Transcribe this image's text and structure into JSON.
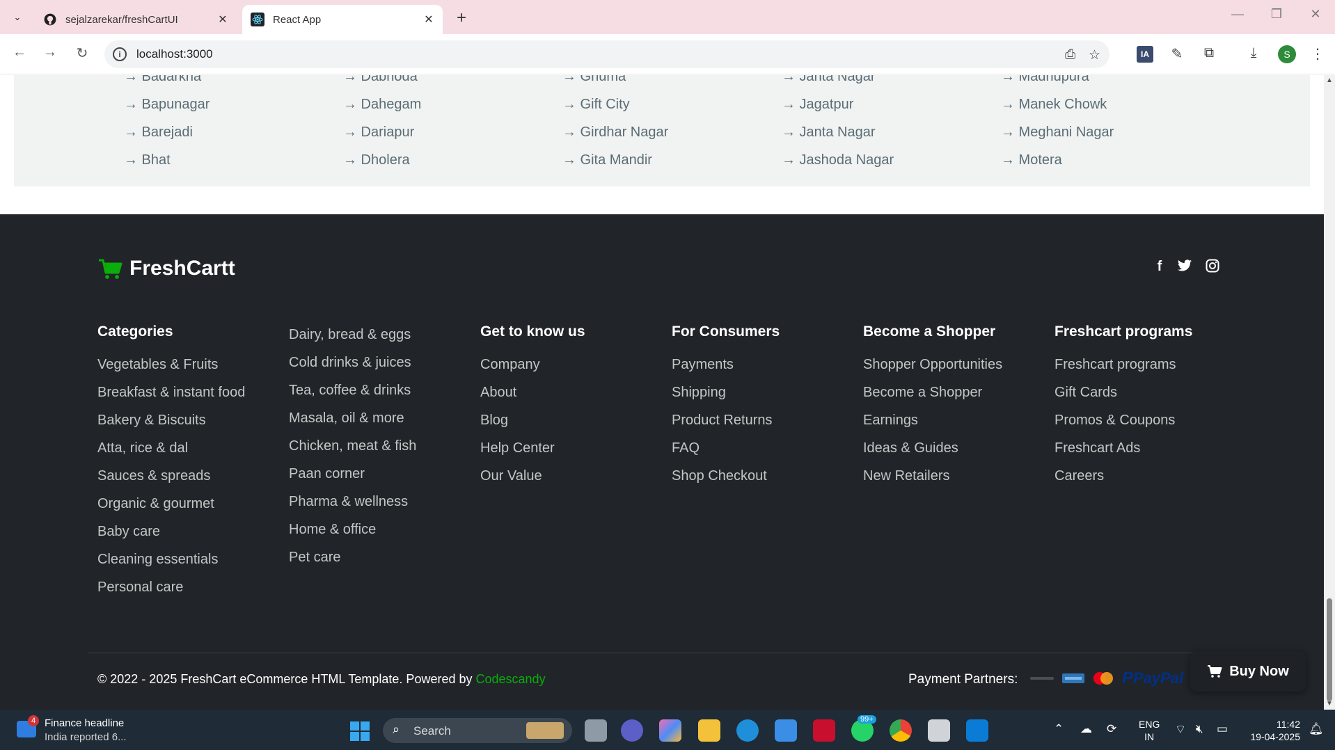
{
  "browser": {
    "tabs": [
      {
        "title": "sejalzarekar/freshCartUI",
        "icon": "github-icon",
        "active": false
      },
      {
        "title": "React App",
        "icon": "react-icon",
        "active": true
      }
    ],
    "new_tab": "+",
    "url": "localhost:3000",
    "profile_initial": "S",
    "extension_badge": "IA"
  },
  "locations": {
    "columns": [
      [
        "→ Badarkha",
        "→ Bapunagar",
        "→ Barejadi",
        "→ Bhat"
      ],
      [
        "→ Dabhoda",
        "→ Dahegam",
        "→ Dariapur",
        "→ Dholera"
      ],
      [
        "→ Ghuma",
        "→ Gift City",
        "→ Girdhar Nagar",
        "→ Gita Mandir"
      ],
      [
        "→ Janta Nagar",
        "→ Jagatpur",
        "→ Janta Nagar",
        "→ Jashoda Nagar"
      ],
      [
        "→ Madhupura",
        "→ Manek Chowk",
        "→ Meghani Nagar",
        "→ Motera"
      ]
    ]
  },
  "footer": {
    "brand": "FreshCartt",
    "social": [
      "facebook-icon",
      "twitter-icon",
      "instagram-icon"
    ],
    "columns": [
      {
        "heading": "Categories",
        "links": [
          "Vegetables & Fruits",
          "Breakfast & instant food",
          "Bakery & Biscuits",
          "Atta, rice & dal",
          "Sauces & spreads",
          "Organic & gourmet",
          "Baby care",
          "Cleaning essentials",
          "Personal care"
        ]
      },
      {
        "heading": "",
        "links": [
          "Dairy, bread & eggs",
          "Cold drinks & juices",
          "Tea, coffee & drinks",
          "Masala, oil & more",
          "Chicken, meat & fish",
          "Paan corner",
          "Pharma & wellness",
          "Home & office",
          "Pet care"
        ]
      },
      {
        "heading": "Get to know us",
        "links": [
          "Company",
          "About",
          "Blog",
          "Help Center",
          "Our Value"
        ]
      },
      {
        "heading": "For Consumers",
        "links": [
          "Payments",
          "Shipping",
          "Product Returns",
          "FAQ",
          "Shop Checkout"
        ]
      },
      {
        "heading": "Become a Shopper",
        "links": [
          "Shopper Opportunities",
          "Become a Shopper",
          "Earnings",
          "Ideas & Guides",
          "New Retailers"
        ]
      },
      {
        "heading": "Freshcart programs",
        "links": [
          "Freshcart programs",
          "Gift Cards",
          "Promos & Coupons",
          "Freshcart Ads",
          "Careers"
        ]
      }
    ],
    "copyright": "© 2022 - 2025 FreshCart eCommerce HTML Template. Powered by ",
    "powered_by": "Codescandy",
    "payment_label": "Payment Partners:",
    "payment_logos": [
      "PayPal"
    ],
    "buy_now": "Buy Now"
  },
  "taskbar": {
    "news_badge": "4",
    "news_title": "Finance headline",
    "news_sub": "India reported 6...",
    "search": "Search",
    "whatsapp_badge": "99+",
    "lang_top": "ENG",
    "lang_bottom": "IN",
    "time": "11:42",
    "date": "19-04-2025"
  },
  "colors": {
    "brand_green": "#0aad0a",
    "footer_bg": "#212529",
    "tabbar_bg": "#f6dde3"
  }
}
